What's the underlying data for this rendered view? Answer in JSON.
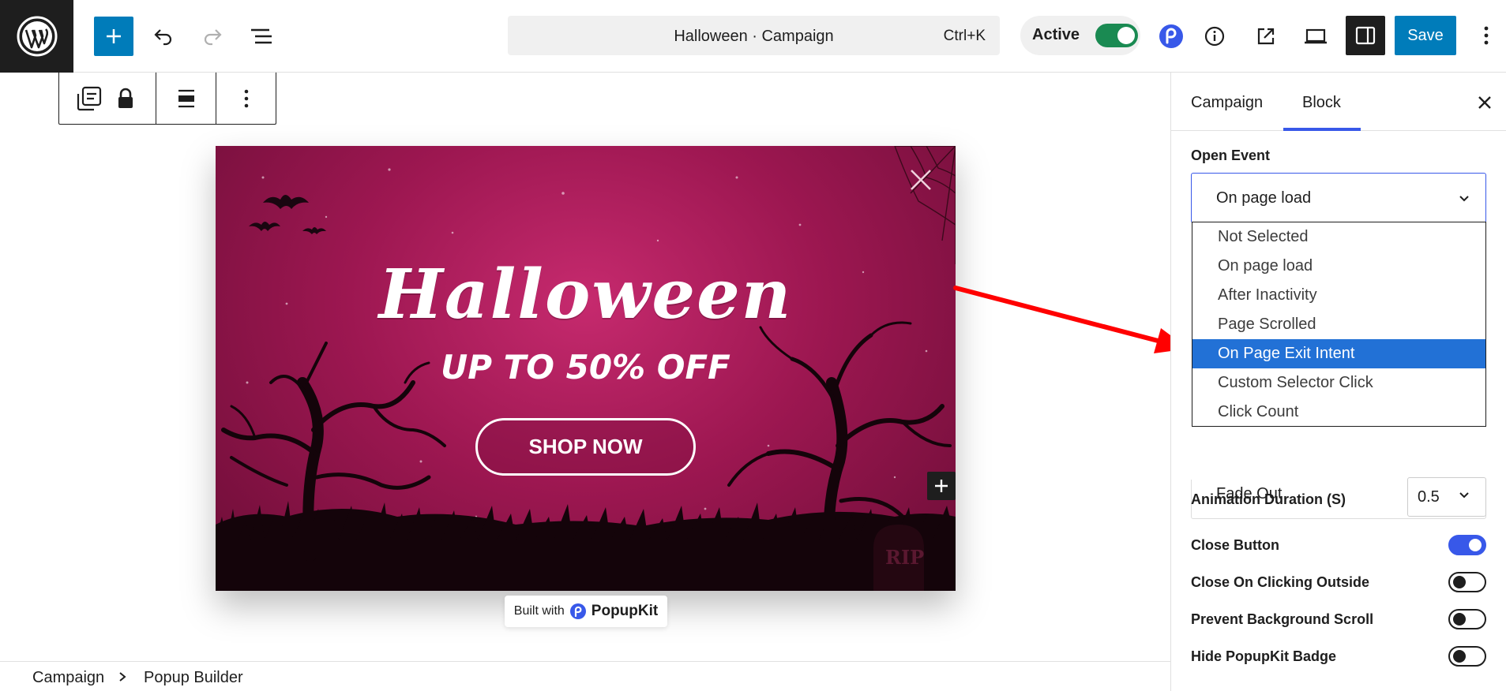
{
  "header": {
    "command_title": "Halloween · Campaign",
    "command_shortcut": "Ctrl+K",
    "active_label": "Active",
    "save_label": "Save"
  },
  "canvas": {
    "post_title_fragment": "een",
    "popup": {
      "title": "Halloween",
      "subtitle": "UP TO 50% OFF",
      "button": "SHOP NOW",
      "bg_color": "#a0195a"
    },
    "badge": {
      "prefix": "Built with",
      "brand": "PopupKit"
    }
  },
  "breadcrumb": {
    "items": [
      "Campaign",
      "Popup Builder"
    ]
  },
  "sidebar": {
    "tabs": [
      {
        "label": "Campaign"
      },
      {
        "label": "Block"
      }
    ],
    "active_tab": "Block",
    "open_event": {
      "label": "Open Event",
      "value": "On page load",
      "options": [
        "Not Selected",
        "On page load",
        "After Inactivity",
        "Page Scrolled",
        "On Page Exit Intent",
        "Custom Selector Click",
        "Click Count"
      ],
      "highlighted": "On Page Exit Intent"
    },
    "close_animation_value": "Fade Out",
    "animation_duration": {
      "label": "Animation Duration (S)",
      "value": "0.5"
    },
    "toggles": [
      {
        "label": "Close Button",
        "on": true
      },
      {
        "label": "Close On Clicking Outside",
        "on": false
      },
      {
        "label": "Prevent Background Scroll",
        "on": false
      },
      {
        "label": "Hide PopupKit Badge",
        "on": false
      }
    ]
  },
  "colors": {
    "accent": "#007cba",
    "active_green": "#1a8a52",
    "wp_blue": "#3858e9",
    "option_highlight": "#2271d6",
    "arrow": "#ff0000"
  }
}
